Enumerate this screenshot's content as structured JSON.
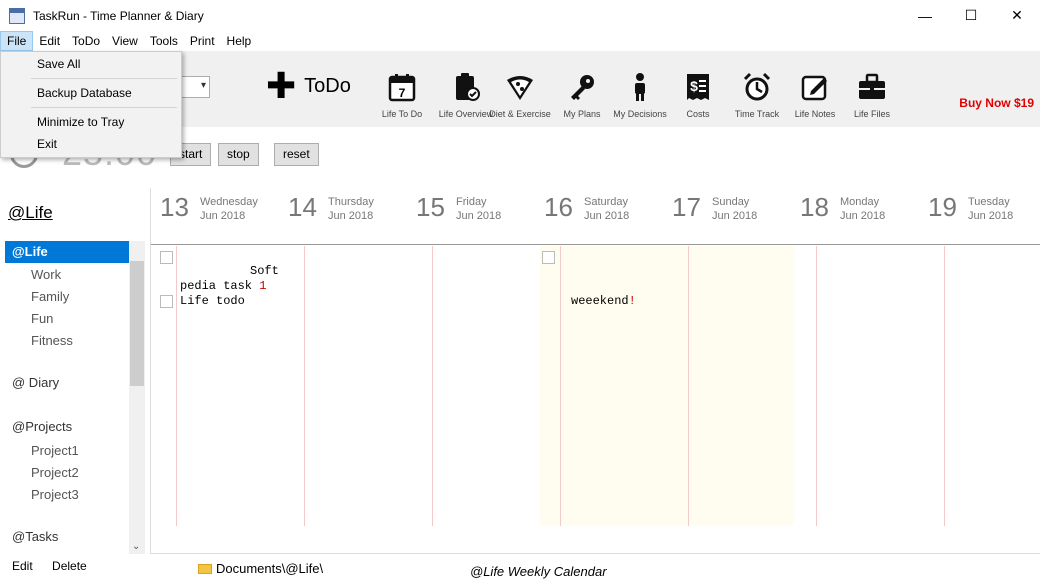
{
  "window": {
    "title": "TaskRun - Time Planner & Diary",
    "minimize": "—",
    "maximize": "☐",
    "close": "✕"
  },
  "menu": [
    "File",
    "Edit",
    "ToDo",
    "View",
    "Tools",
    "Print",
    "Help"
  ],
  "file_menu": {
    "items": [
      "Save All",
      "Backup Database",
      "Minimize to Tray",
      "Exit"
    ]
  },
  "toolbar": {
    "todo_label": "ToDo",
    "tools": [
      {
        "label": "Life To Do",
        "icon": "calendar-icon"
      },
      {
        "label": "Life Overview",
        "icon": "clipboard-check-icon"
      },
      {
        "label": "Diet & Exercise",
        "icon": "pizza-icon"
      },
      {
        "label": "My Plans",
        "icon": "key-icon"
      },
      {
        "label": "My Decisions",
        "icon": "person-icon"
      },
      {
        "label": "Costs",
        "icon": "receipt-dollar-icon"
      },
      {
        "label": "Time Track",
        "icon": "alarm-clock-icon"
      },
      {
        "label": "Life Notes",
        "icon": "edit-note-icon"
      },
      {
        "label": "Life Files",
        "icon": "briefcase-icon"
      }
    ],
    "calendar_day": "7",
    "buy": "Buy Now $19"
  },
  "timer": {
    "display": "25:00",
    "start": "start",
    "stop": "stop",
    "reset": "reset"
  },
  "sidebar": {
    "title": "@Life",
    "items": [
      {
        "label": "@Life",
        "kind": "head",
        "selected": true
      },
      {
        "label": "Work",
        "kind": "child"
      },
      {
        "label": "Family",
        "kind": "child"
      },
      {
        "label": "Fun",
        "kind": "child"
      },
      {
        "label": "Fitness",
        "kind": "child"
      },
      {
        "label": "@ Diary",
        "kind": "head"
      },
      {
        "label": "@Projects",
        "kind": "head"
      },
      {
        "label": "Project1",
        "kind": "child"
      },
      {
        "label": "Project2",
        "kind": "child"
      },
      {
        "label": "Project3",
        "kind": "child"
      },
      {
        "label": "@Tasks",
        "kind": "head"
      }
    ],
    "edit": "Edit",
    "delete": "Delete"
  },
  "status": {
    "path": "Documents\\@Life\\",
    "caption": "@Life Weekly Calendar"
  },
  "calendar": {
    "days": [
      {
        "num": "13",
        "name": "Wednesday",
        "month": "Jun 2018"
      },
      {
        "num": "14",
        "name": "Thursday",
        "month": "Jun 2018"
      },
      {
        "num": "15",
        "name": "Friday",
        "month": "Jun 2018"
      },
      {
        "num": "16",
        "name": "Saturday",
        "month": "Jun 2018"
      },
      {
        "num": "17",
        "name": "Sunday",
        "month": "Jun 2018"
      },
      {
        "num": "18",
        "name": "Monday",
        "month": "Jun 2018"
      },
      {
        "num": "19",
        "name": "Tuesday",
        "month": "Jun 2018"
      }
    ],
    "notes": {
      "d13_line1": "Soft",
      "d13_line2": "pedia task ",
      "d13_line2_num": "1",
      "d13_line3": "Life todo",
      "d16_text": "weeekend",
      "d16_bang": "!"
    }
  }
}
